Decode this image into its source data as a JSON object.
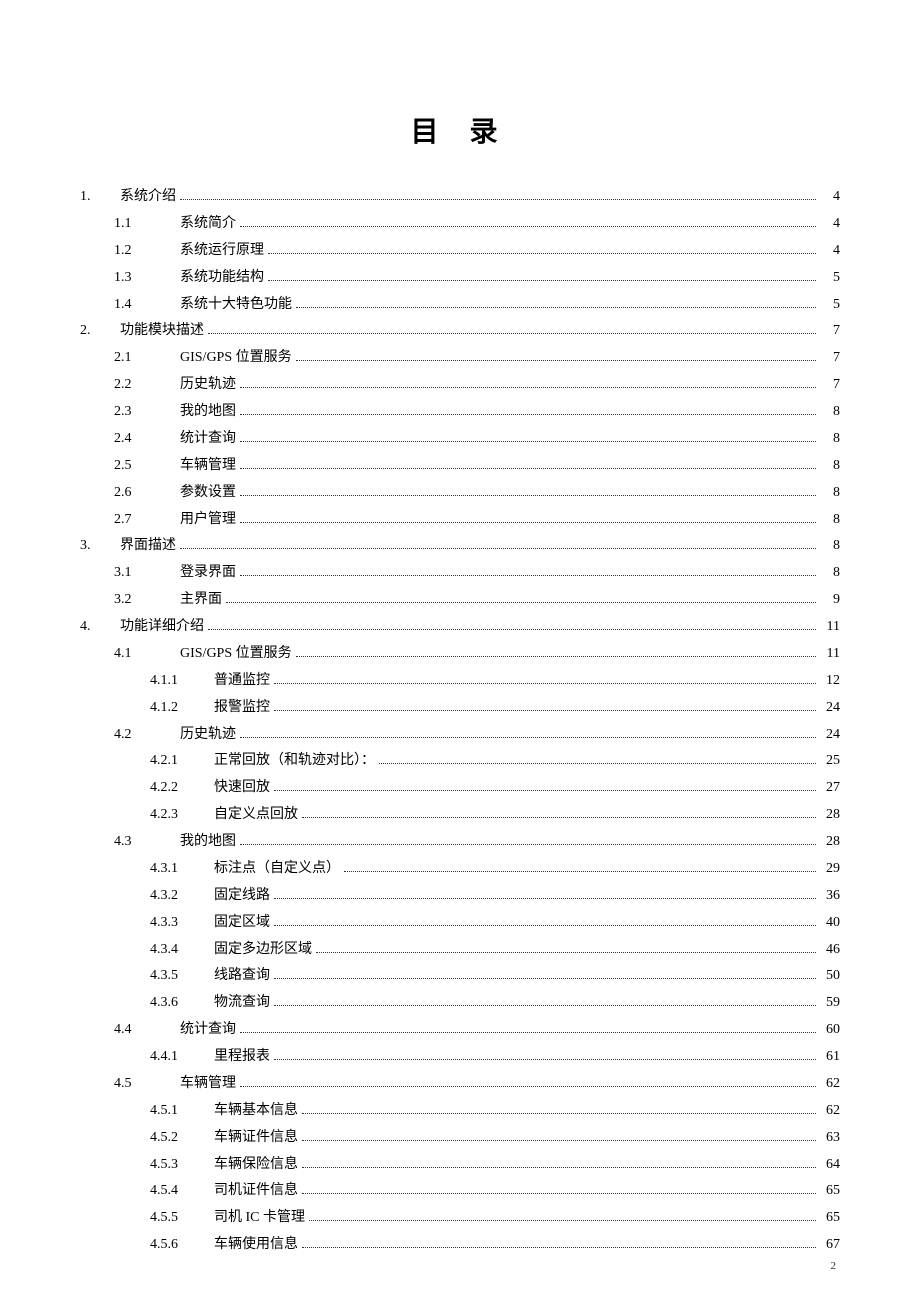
{
  "title": "目 录",
  "page_number": "2",
  "toc": [
    {
      "level": 1,
      "num": "1.",
      "text": "系统介绍",
      "page": "4"
    },
    {
      "level": 2,
      "num": "1.1",
      "text": "系统简介",
      "page": "4"
    },
    {
      "level": 2,
      "num": "1.2",
      "text": "系统运行原理",
      "page": "4"
    },
    {
      "level": 2,
      "num": "1.3",
      "text": "系统功能结构",
      "page": "5"
    },
    {
      "level": 2,
      "num": "1.4",
      "text": "系统十大特色功能",
      "page": "5"
    },
    {
      "level": 1,
      "num": "2.",
      "text": "功能模块描述",
      "page": "7"
    },
    {
      "level": 2,
      "num": "2.1",
      "text": "GIS/GPS 位置服务",
      "page": "7"
    },
    {
      "level": 2,
      "num": "2.2",
      "text": "历史轨迹",
      "page": "7"
    },
    {
      "level": 2,
      "num": "2.3",
      "text": "我的地图",
      "page": "8"
    },
    {
      "level": 2,
      "num": "2.4",
      "text": "统计查询",
      "page": "8"
    },
    {
      "level": 2,
      "num": "2.5",
      "text": "车辆管理",
      "page": "8"
    },
    {
      "level": 2,
      "num": "2.6",
      "text": "参数设置",
      "page": "8"
    },
    {
      "level": 2,
      "num": "2.7",
      "text": "用户管理",
      "page": "8"
    },
    {
      "level": 1,
      "num": "3.",
      "text": "界面描述",
      "page": "8"
    },
    {
      "level": 2,
      "num": "3.1",
      "text": "登录界面",
      "page": "8"
    },
    {
      "level": 2,
      "num": "3.2",
      "text": "主界面",
      "page": "9"
    },
    {
      "level": 1,
      "num": "4.",
      "text": "功能详细介绍",
      "page": "11"
    },
    {
      "level": 2,
      "num": "4.1",
      "text": "GIS/GPS 位置服务",
      "page": "11"
    },
    {
      "level": 3,
      "num": "4.1.1",
      "text": "普通监控",
      "page": "12"
    },
    {
      "level": 3,
      "num": "4.1.2",
      "text": "报警监控",
      "page": "24"
    },
    {
      "level": 2,
      "num": "4.2",
      "text": "历史轨迹",
      "page": "24"
    },
    {
      "level": 3,
      "num": "4.2.1",
      "text": "正常回放（和轨迹对比）：",
      "page": "25"
    },
    {
      "level": 3,
      "num": "4.2.2",
      "text": "快速回放",
      "page": "27"
    },
    {
      "level": 3,
      "num": "4.2.3",
      "text": "自定义点回放",
      "page": "28"
    },
    {
      "level": 2,
      "num": "4.3",
      "text": "我的地图",
      "page": "28"
    },
    {
      "level": 3,
      "num": "4.3.1",
      "text": "标注点（自定义点）",
      "page": "29"
    },
    {
      "level": 3,
      "num": "4.3.2",
      "text": "固定线路",
      "page": "36"
    },
    {
      "level": 3,
      "num": "4.3.3",
      "text": "固定区域",
      "page": "40"
    },
    {
      "level": 3,
      "num": "4.3.4",
      "text": "固定多边形区域",
      "page": "46"
    },
    {
      "level": 3,
      "num": "4.3.5",
      "text": "线路查询",
      "page": "50"
    },
    {
      "level": 3,
      "num": "4.3.6",
      "text": "物流查询",
      "page": "59"
    },
    {
      "level": 2,
      "num": "4.4",
      "text": "统计查询",
      "page": "60"
    },
    {
      "level": 3,
      "num": "4.4.1",
      "text": "里程报表",
      "page": "61"
    },
    {
      "level": 2,
      "num": "4.5",
      "text": "车辆管理",
      "page": "62"
    },
    {
      "level": 3,
      "num": "4.5.1",
      "text": "车辆基本信息",
      "page": "62"
    },
    {
      "level": 3,
      "num": "4.5.2",
      "text": "车辆证件信息",
      "page": "63"
    },
    {
      "level": 3,
      "num": "4.5.3",
      "text": "车辆保险信息",
      "page": "64"
    },
    {
      "level": 3,
      "num": "4.5.4",
      "text": "司机证件信息",
      "page": "65"
    },
    {
      "level": 3,
      "num": "4.5.5",
      "text": "司机 IC 卡管理",
      "page": "65"
    },
    {
      "level": 3,
      "num": "4.5.6",
      "text": "车辆使用信息",
      "page": "67"
    }
  ]
}
